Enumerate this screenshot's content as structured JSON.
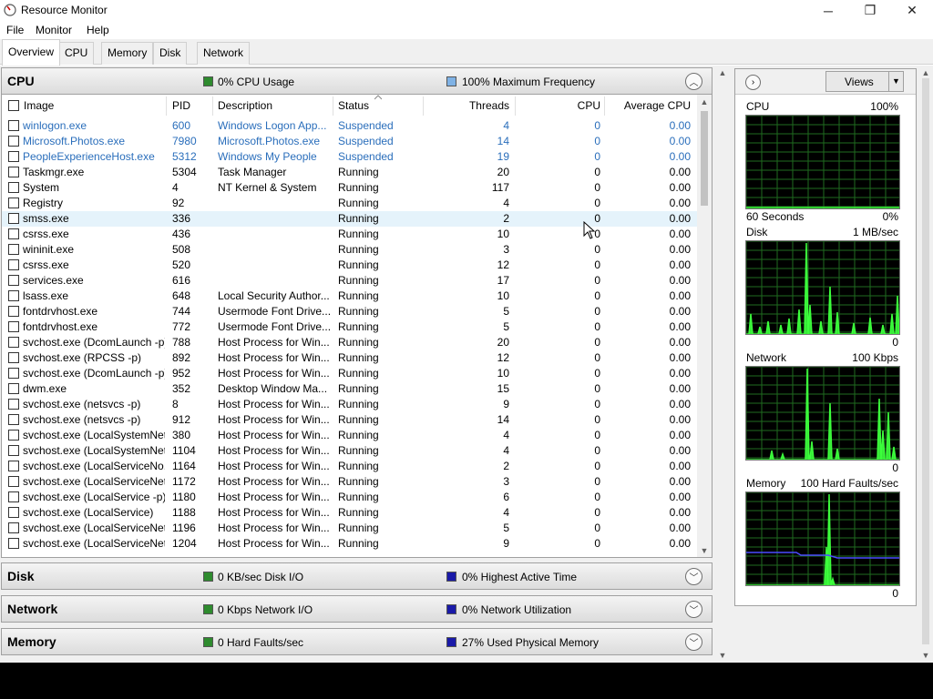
{
  "window": {
    "title": "Resource Monitor",
    "minimize_glyph": "─",
    "maximize_glyph": "❐",
    "close_glyph": "✕"
  },
  "menu": [
    "File",
    "Monitor",
    "Help"
  ],
  "tabs": [
    "Overview",
    "CPU",
    "Memory",
    "Disk",
    "Network"
  ],
  "active_tab": "Overview",
  "sections": {
    "cpu": {
      "title": "CPU",
      "legend1": "0% CPU Usage",
      "legend2": "100% Maximum Frequency",
      "legend1_color": "#2e8b2e",
      "legend2_color": "#7fb2e5",
      "toggle": "︿"
    },
    "disk": {
      "title": "Disk",
      "legend1": "0 KB/sec Disk I/O",
      "legend2": "0% Highest Active Time",
      "legend1_color": "#2e8b2e",
      "legend2_color": "#1a1aa8",
      "toggle": "﹀"
    },
    "network": {
      "title": "Network",
      "legend1": "0 Kbps Network I/O",
      "legend2": "0% Network Utilization",
      "legend1_color": "#2e8b2e",
      "legend2_color": "#1a1aa8",
      "toggle": "﹀"
    },
    "memory": {
      "title": "Memory",
      "legend1": "0 Hard Faults/sec",
      "legend2": "27% Used Physical Memory",
      "legend1_color": "#2e8b2e",
      "legend2_color": "#1a1aa8",
      "toggle": "﹀"
    }
  },
  "process_table": {
    "columns": [
      "Image",
      "PID",
      "Description",
      "Status",
      "Threads",
      "CPU",
      "Average CPU"
    ],
    "sorted_column": "Status",
    "rows": [
      {
        "image": "winlogon.exe",
        "pid": "600",
        "desc": "Windows Logon App...",
        "status": "Suspended",
        "threads": "4",
        "cpu": "0",
        "avg": "0.00",
        "suspended": true
      },
      {
        "image": "Microsoft.Photos.exe",
        "pid": "7980",
        "desc": "Microsoft.Photos.exe",
        "status": "Suspended",
        "threads": "14",
        "cpu": "0",
        "avg": "0.00",
        "suspended": true
      },
      {
        "image": "PeopleExperienceHost.exe",
        "pid": "5312",
        "desc": "Windows My People",
        "status": "Suspended",
        "threads": "19",
        "cpu": "0",
        "avg": "0.00",
        "suspended": true
      },
      {
        "image": "Taskmgr.exe",
        "pid": "5304",
        "desc": "Task Manager",
        "status": "Running",
        "threads": "20",
        "cpu": "0",
        "avg": "0.00"
      },
      {
        "image": "System",
        "pid": "4",
        "desc": "NT Kernel & System",
        "status": "Running",
        "threads": "117",
        "cpu": "0",
        "avg": "0.00"
      },
      {
        "image": "Registry",
        "pid": "92",
        "desc": "",
        "status": "Running",
        "threads": "4",
        "cpu": "0",
        "avg": "0.00"
      },
      {
        "image": "smss.exe",
        "pid": "336",
        "desc": "",
        "status": "Running",
        "threads": "2",
        "cpu": "0",
        "avg": "0.00",
        "hover": true
      },
      {
        "image": "csrss.exe",
        "pid": "436",
        "desc": "",
        "status": "Running",
        "threads": "10",
        "cpu": "0",
        "avg": "0.00"
      },
      {
        "image": "wininit.exe",
        "pid": "508",
        "desc": "",
        "status": "Running",
        "threads": "3",
        "cpu": "0",
        "avg": "0.00"
      },
      {
        "image": "csrss.exe",
        "pid": "520",
        "desc": "",
        "status": "Running",
        "threads": "12",
        "cpu": "0",
        "avg": "0.00"
      },
      {
        "image": "services.exe",
        "pid": "616",
        "desc": "",
        "status": "Running",
        "threads": "17",
        "cpu": "0",
        "avg": "0.00"
      },
      {
        "image": "lsass.exe",
        "pid": "648",
        "desc": "Local Security Author...",
        "status": "Running",
        "threads": "10",
        "cpu": "0",
        "avg": "0.00"
      },
      {
        "image": "fontdrvhost.exe",
        "pid": "744",
        "desc": "Usermode Font Drive...",
        "status": "Running",
        "threads": "5",
        "cpu": "0",
        "avg": "0.00"
      },
      {
        "image": "fontdrvhost.exe",
        "pid": "772",
        "desc": "Usermode Font Drive...",
        "status": "Running",
        "threads": "5",
        "cpu": "0",
        "avg": "0.00"
      },
      {
        "image": "svchost.exe (DcomLaunch -p)",
        "pid": "788",
        "desc": "Host Process for Win...",
        "status": "Running",
        "threads": "20",
        "cpu": "0",
        "avg": "0.00"
      },
      {
        "image": "svchost.exe (RPCSS -p)",
        "pid": "892",
        "desc": "Host Process for Win...",
        "status": "Running",
        "threads": "12",
        "cpu": "0",
        "avg": "0.00"
      },
      {
        "image": "svchost.exe (DcomLaunch -p)",
        "pid": "952",
        "desc": "Host Process for Win...",
        "status": "Running",
        "threads": "10",
        "cpu": "0",
        "avg": "0.00"
      },
      {
        "image": "dwm.exe",
        "pid": "352",
        "desc": "Desktop Window Ma...",
        "status": "Running",
        "threads": "15",
        "cpu": "0",
        "avg": "0.00"
      },
      {
        "image": "svchost.exe (netsvcs -p)",
        "pid": "8",
        "desc": "Host Process for Win...",
        "status": "Running",
        "threads": "9",
        "cpu": "0",
        "avg": "0.00"
      },
      {
        "image": "svchost.exe (netsvcs -p)",
        "pid": "912",
        "desc": "Host Process for Win...",
        "status": "Running",
        "threads": "14",
        "cpu": "0",
        "avg": "0.00"
      },
      {
        "image": "svchost.exe (LocalSystemNet...",
        "pid": "380",
        "desc": "Host Process for Win...",
        "status": "Running",
        "threads": "4",
        "cpu": "0",
        "avg": "0.00"
      },
      {
        "image": "svchost.exe (LocalSystemNet...",
        "pid": "1104",
        "desc": "Host Process for Win...",
        "status": "Running",
        "threads": "4",
        "cpu": "0",
        "avg": "0.00"
      },
      {
        "image": "svchost.exe (LocalServiceNo...",
        "pid": "1164",
        "desc": "Host Process for Win...",
        "status": "Running",
        "threads": "2",
        "cpu": "0",
        "avg": "0.00"
      },
      {
        "image": "svchost.exe (LocalServiceNet...",
        "pid": "1172",
        "desc": "Host Process for Win...",
        "status": "Running",
        "threads": "3",
        "cpu": "0",
        "avg": "0.00"
      },
      {
        "image": "svchost.exe (LocalService -p)",
        "pid": "1180",
        "desc": "Host Process for Win...",
        "status": "Running",
        "threads": "6",
        "cpu": "0",
        "avg": "0.00"
      },
      {
        "image": "svchost.exe (LocalService)",
        "pid": "1188",
        "desc": "Host Process for Win...",
        "status": "Running",
        "threads": "4",
        "cpu": "0",
        "avg": "0.00"
      },
      {
        "image": "svchost.exe (LocalServiceNet...",
        "pid": "1196",
        "desc": "Host Process for Win...",
        "status": "Running",
        "threads": "5",
        "cpu": "0",
        "avg": "0.00"
      },
      {
        "image": "svchost.exe (LocalServiceNet...",
        "pid": "1204",
        "desc": "Host Process for Win...",
        "status": "Running",
        "threads": "9",
        "cpu": "0",
        "avg": "0.00"
      }
    ]
  },
  "right_pane": {
    "views_label": "Views",
    "graphs": [
      {
        "label": "CPU",
        "top_right": "100%",
        "bottom_left": "60 Seconds",
        "bottom_right": "0%"
      },
      {
        "label": "Disk",
        "top_right": "1 MB/sec",
        "bottom_left": "",
        "bottom_right": "0"
      },
      {
        "label": "Network",
        "top_right": "100 Kbps",
        "bottom_left": "",
        "bottom_right": "0"
      },
      {
        "label": "Memory",
        "top_right": "100 Hard Faults/sec",
        "bottom_left": "",
        "bottom_right": "0"
      }
    ]
  }
}
